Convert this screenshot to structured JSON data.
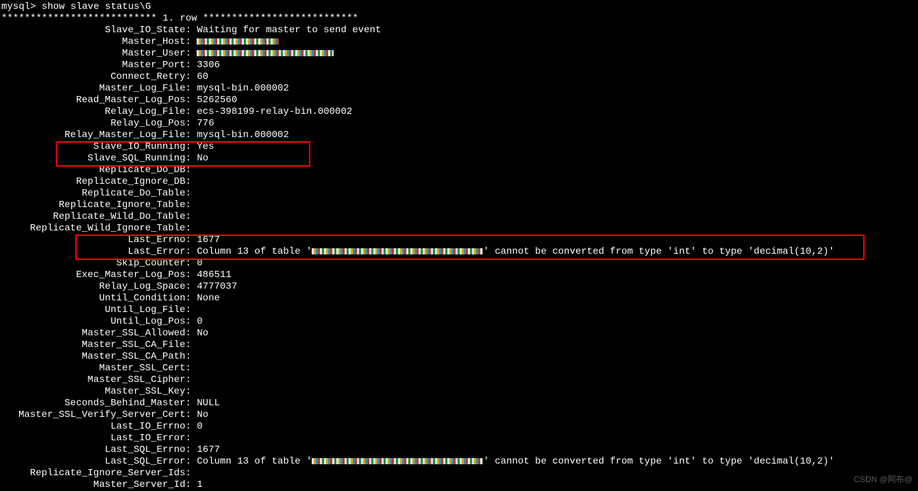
{
  "prompt": "mysql> show slave status\\G",
  "row_sep": "*************************** 1. row ***************************",
  "status": [
    {
      "label": "Slave_IO_State",
      "value": "Waiting for master to send event"
    },
    {
      "label": "Master_Host",
      "redacted": "short"
    },
    {
      "label": "Master_User",
      "redacted": "med"
    },
    {
      "label": "Master_Port",
      "value": "3306"
    },
    {
      "label": "Connect_Retry",
      "value": "60"
    },
    {
      "label": "Master_Log_File",
      "value": "mysql-bin.000002"
    },
    {
      "label": "Read_Master_Log_Pos",
      "value": "5262560"
    },
    {
      "label": "Relay_Log_File",
      "value": "ecs-398199-relay-bin.000002"
    },
    {
      "label": "Relay_Log_Pos",
      "value": "776"
    },
    {
      "label": "Relay_Master_Log_File",
      "value": "mysql-bin.000002"
    },
    {
      "label": "Slave_IO_Running",
      "value": "Yes"
    },
    {
      "label": "Slave_SQL_Running",
      "value": "No"
    },
    {
      "label": "Replicate_Do_DB",
      "value": ""
    },
    {
      "label": "Replicate_Ignore_DB",
      "value": ""
    },
    {
      "label": "Replicate_Do_Table",
      "value": ""
    },
    {
      "label": "Replicate_Ignore_Table",
      "value": ""
    },
    {
      "label": "Replicate_Wild_Do_Table",
      "value": ""
    },
    {
      "label": "Replicate_Wild_Ignore_Table",
      "value": ""
    },
    {
      "label": "Last_Errno",
      "value": "1677"
    },
    {
      "label": "Last_Error",
      "value_parts": [
        "Column 13 of table '",
        "REDACT_LONG",
        "' cannot be converted from type 'int' to type 'decimal(10,2)'"
      ]
    },
    {
      "label": "Skip_Counter",
      "value": "0"
    },
    {
      "label": "Exec_Master_Log_Pos",
      "value": "486511"
    },
    {
      "label": "Relay_Log_Space",
      "value": "4777037"
    },
    {
      "label": "Until_Condition",
      "value": "None"
    },
    {
      "label": "Until_Log_File",
      "value": ""
    },
    {
      "label": "Until_Log_Pos",
      "value": "0"
    },
    {
      "label": "Master_SSL_Allowed",
      "value": "No"
    },
    {
      "label": "Master_SSL_CA_File",
      "value": ""
    },
    {
      "label": "Master_SSL_CA_Path",
      "value": ""
    },
    {
      "label": "Master_SSL_Cert",
      "value": ""
    },
    {
      "label": "Master_SSL_Cipher",
      "value": ""
    },
    {
      "label": "Master_SSL_Key",
      "value": ""
    },
    {
      "label": "Seconds_Behind_Master",
      "value": "NULL"
    },
    {
      "label": "Master_SSL_Verify_Server_Cert",
      "value": "No"
    },
    {
      "label": "Last_IO_Errno",
      "value": "0"
    },
    {
      "label": "Last_IO_Error",
      "value": ""
    },
    {
      "label": "Last_SQL_Errno",
      "value": "1677"
    },
    {
      "label": "Last_SQL_Error",
      "value_parts": [
        "Column 13 of table '",
        "REDACT_LONG",
        "' cannot be converted from type 'int' to type 'decimal(10,2)'"
      ]
    },
    {
      "label": "Replicate_Ignore_Server_Ids",
      "value": ""
    },
    {
      "label": "Master_Server_Id",
      "value": "1"
    }
  ],
  "watermark": "CSDN @阿布@"
}
